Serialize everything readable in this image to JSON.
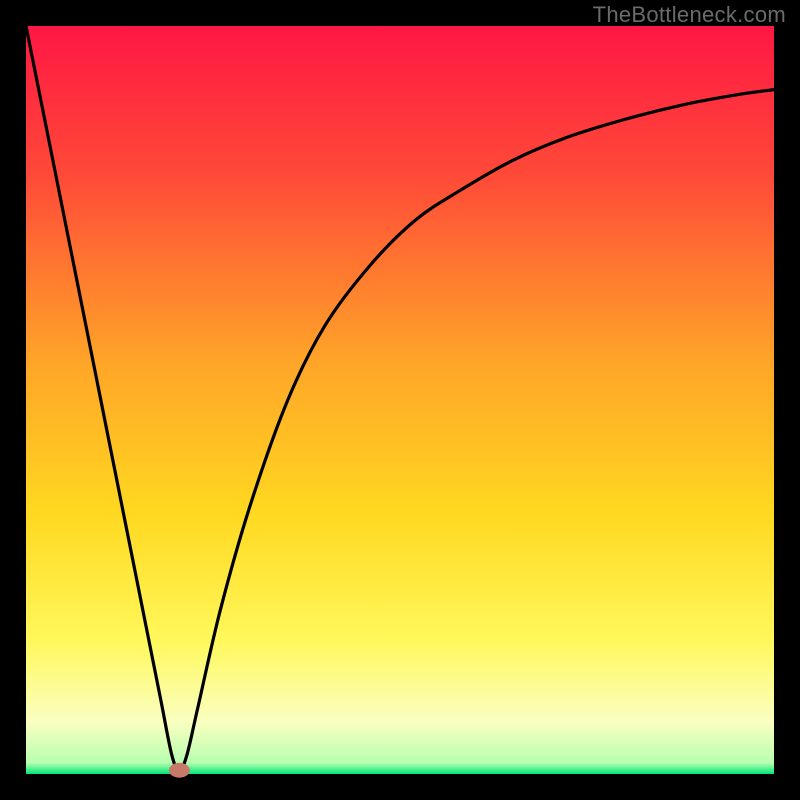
{
  "watermark": "TheBottleneck.com",
  "colors": {
    "gradient_top": "#ff1744",
    "gradient_upper": "#ff5530",
    "gradient_mid": "#ffb020",
    "gradient_lower": "#ffe030",
    "gradient_pale": "#fffccf",
    "gradient_bottom": "#00e676",
    "frame": "#000000",
    "curve": "#000000",
    "marker": "#c57a6a"
  },
  "chart_data": {
    "type": "line",
    "title": "",
    "xlabel": "",
    "ylabel": "",
    "xlim": [
      0,
      100
    ],
    "ylim": [
      0,
      100
    ],
    "grid": false,
    "frame_thickness_px": 26,
    "gradient_stops": [
      {
        "offset": 0.0,
        "color": "#ff1744"
      },
      {
        "offset": 0.2,
        "color": "#ff4a38"
      },
      {
        "offset": 0.45,
        "color": "#ffa528"
      },
      {
        "offset": 0.65,
        "color": "#ffd820"
      },
      {
        "offset": 0.82,
        "color": "#fff85a"
      },
      {
        "offset": 0.93,
        "color": "#faffc0"
      },
      {
        "offset": 0.985,
        "color": "#b8ffb0"
      },
      {
        "offset": 1.0,
        "color": "#00e676"
      }
    ],
    "series": [
      {
        "name": "bottleneck-curve",
        "x": [
          0,
          2,
          4,
          6,
          8,
          10,
          12,
          14,
          16,
          18,
          19.5,
          20.5,
          21.5,
          23,
          26,
          30,
          35,
          40,
          46,
          52,
          58,
          65,
          72,
          80,
          88,
          95,
          100
        ],
        "y": [
          100,
          90,
          80,
          70,
          60,
          50,
          40,
          30,
          20,
          10,
          2.5,
          0.5,
          2.5,
          9,
          22,
          36,
          50,
          60,
          68,
          74,
          78,
          82,
          85,
          87.5,
          89.5,
          90.8,
          91.5
        ]
      }
    ],
    "marker": {
      "x": 20.5,
      "y": 0.5,
      "rx": 1.4,
      "ry": 1.0
    }
  }
}
